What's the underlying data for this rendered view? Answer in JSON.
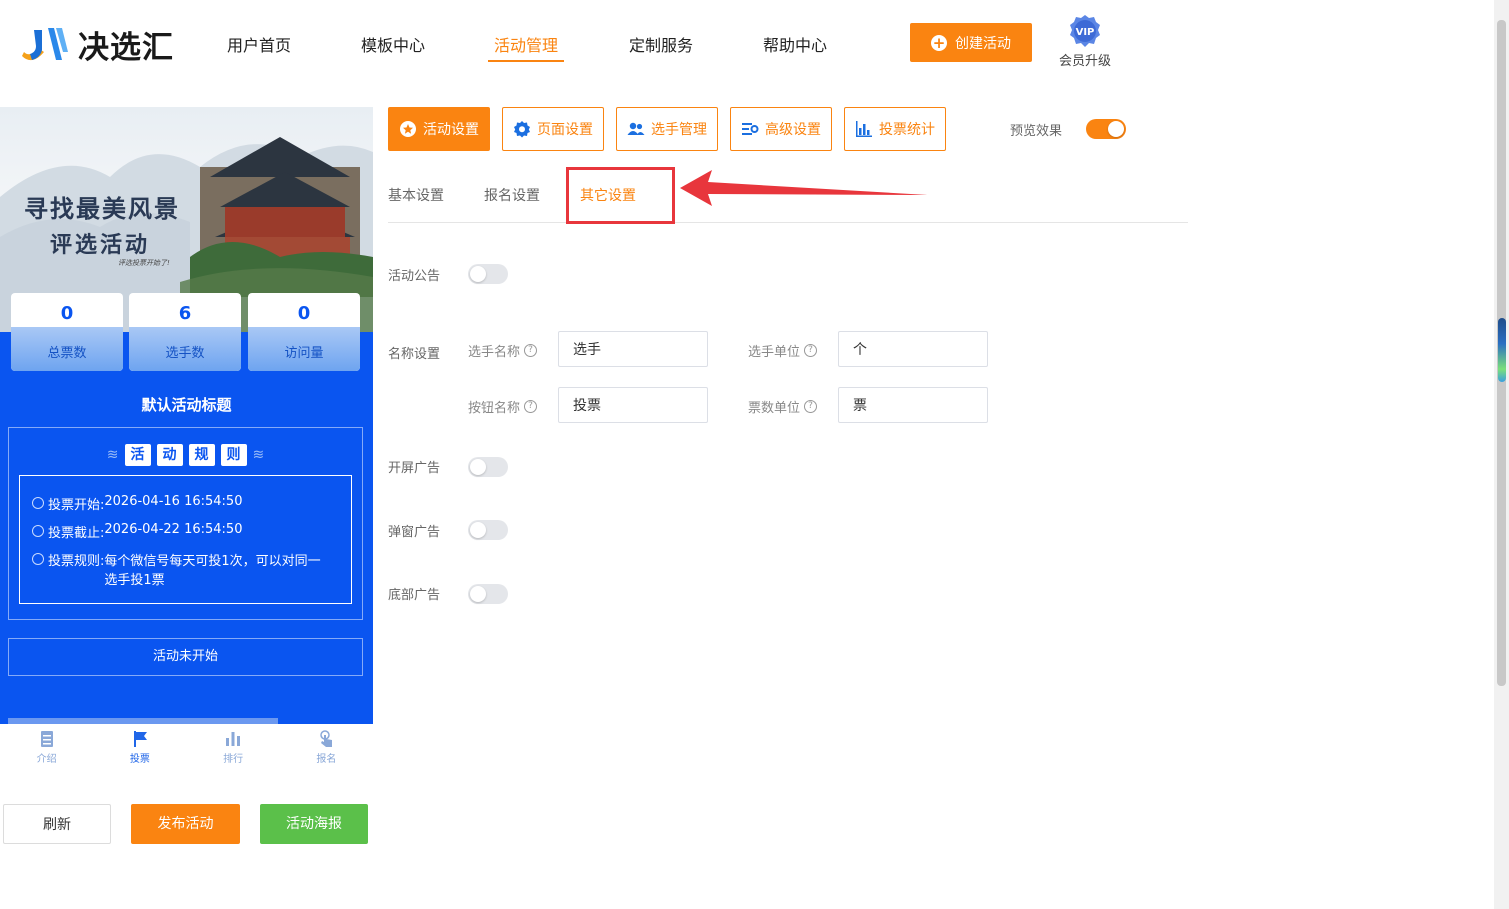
{
  "app": {
    "logo_text": "决选汇"
  },
  "nav": {
    "items": [
      {
        "label": "用户首页"
      },
      {
        "label": "模板中心"
      },
      {
        "label": "活动管理",
        "active": true
      },
      {
        "label": "定制服务"
      },
      {
        "label": "帮助中心"
      }
    ],
    "create_button": "创建活动",
    "vip_badge": "VIP",
    "vip_label": "会员升级"
  },
  "preview": {
    "banner_line1": "寻找最美风景",
    "banner_line2": "评选活动",
    "banner_small": "评选投票开始了!",
    "stats": [
      {
        "value": "0",
        "label": "总票数"
      },
      {
        "value": "6",
        "label": "选手数"
      },
      {
        "value": "0",
        "label": "访问量"
      }
    ],
    "activity_title": "默认活动标题",
    "rules_heading": [
      "活",
      "动",
      "规",
      "则"
    ],
    "rules": [
      {
        "label": "投票开始:",
        "value": "2026-04-16 16:54:50"
      },
      {
        "label": "投票截止:",
        "value": "2026-04-22 16:54:50"
      },
      {
        "label": "投票规则:",
        "value": "每个微信号每天可投1次，可以对同一",
        "value2": "选手投1票"
      }
    ],
    "status": "活动未开始",
    "tabs": [
      {
        "label": "介绍",
        "icon": "doc-icon"
      },
      {
        "label": "投票",
        "icon": "flag-icon",
        "active": true
      },
      {
        "label": "排行",
        "icon": "bar-chart-icon"
      },
      {
        "label": "报名",
        "icon": "hand-tap-icon"
      }
    ]
  },
  "bottom_buttons": {
    "refresh": "刷新",
    "publish": "发布活动",
    "poster": "活动海报"
  },
  "toolbar": {
    "buttons": [
      {
        "label": "活动设置",
        "icon": "star-icon",
        "active": true
      },
      {
        "label": "页面设置",
        "icon": "gear-icon"
      },
      {
        "label": "选手管理",
        "icon": "users-icon"
      },
      {
        "label": "高级设置",
        "icon": "sliders-icon"
      },
      {
        "label": "投票统计",
        "icon": "bar-chart-icon"
      }
    ],
    "preview_label": "预览效果",
    "preview_on": true
  },
  "sub_tabs": [
    {
      "label": "基本设置"
    },
    {
      "label": "报名设置"
    },
    {
      "label": "其它设置",
      "active": true
    }
  ],
  "form": {
    "announcement_label": "活动公告",
    "announcement_on": false,
    "names_label": "名称设置",
    "contestant_name_label": "选手名称",
    "contestant_name_value": "选手",
    "contestant_unit_label": "选手单位",
    "contestant_unit_value": "个",
    "button_name_label": "按钮名称",
    "button_name_value": "投票",
    "vote_unit_label": "票数单位",
    "vote_unit_value": "票",
    "splash_ad_label": "开屏广告",
    "splash_ad_on": false,
    "popup_ad_label": "弹窗广告",
    "popup_ad_on": false,
    "bottom_ad_label": "底部广告",
    "bottom_ad_on": false
  },
  "colors": {
    "accent": "#fa8411",
    "preview_blue": "#0a55f0",
    "green": "#5bc04a",
    "annotation_red": "#e8363c"
  }
}
